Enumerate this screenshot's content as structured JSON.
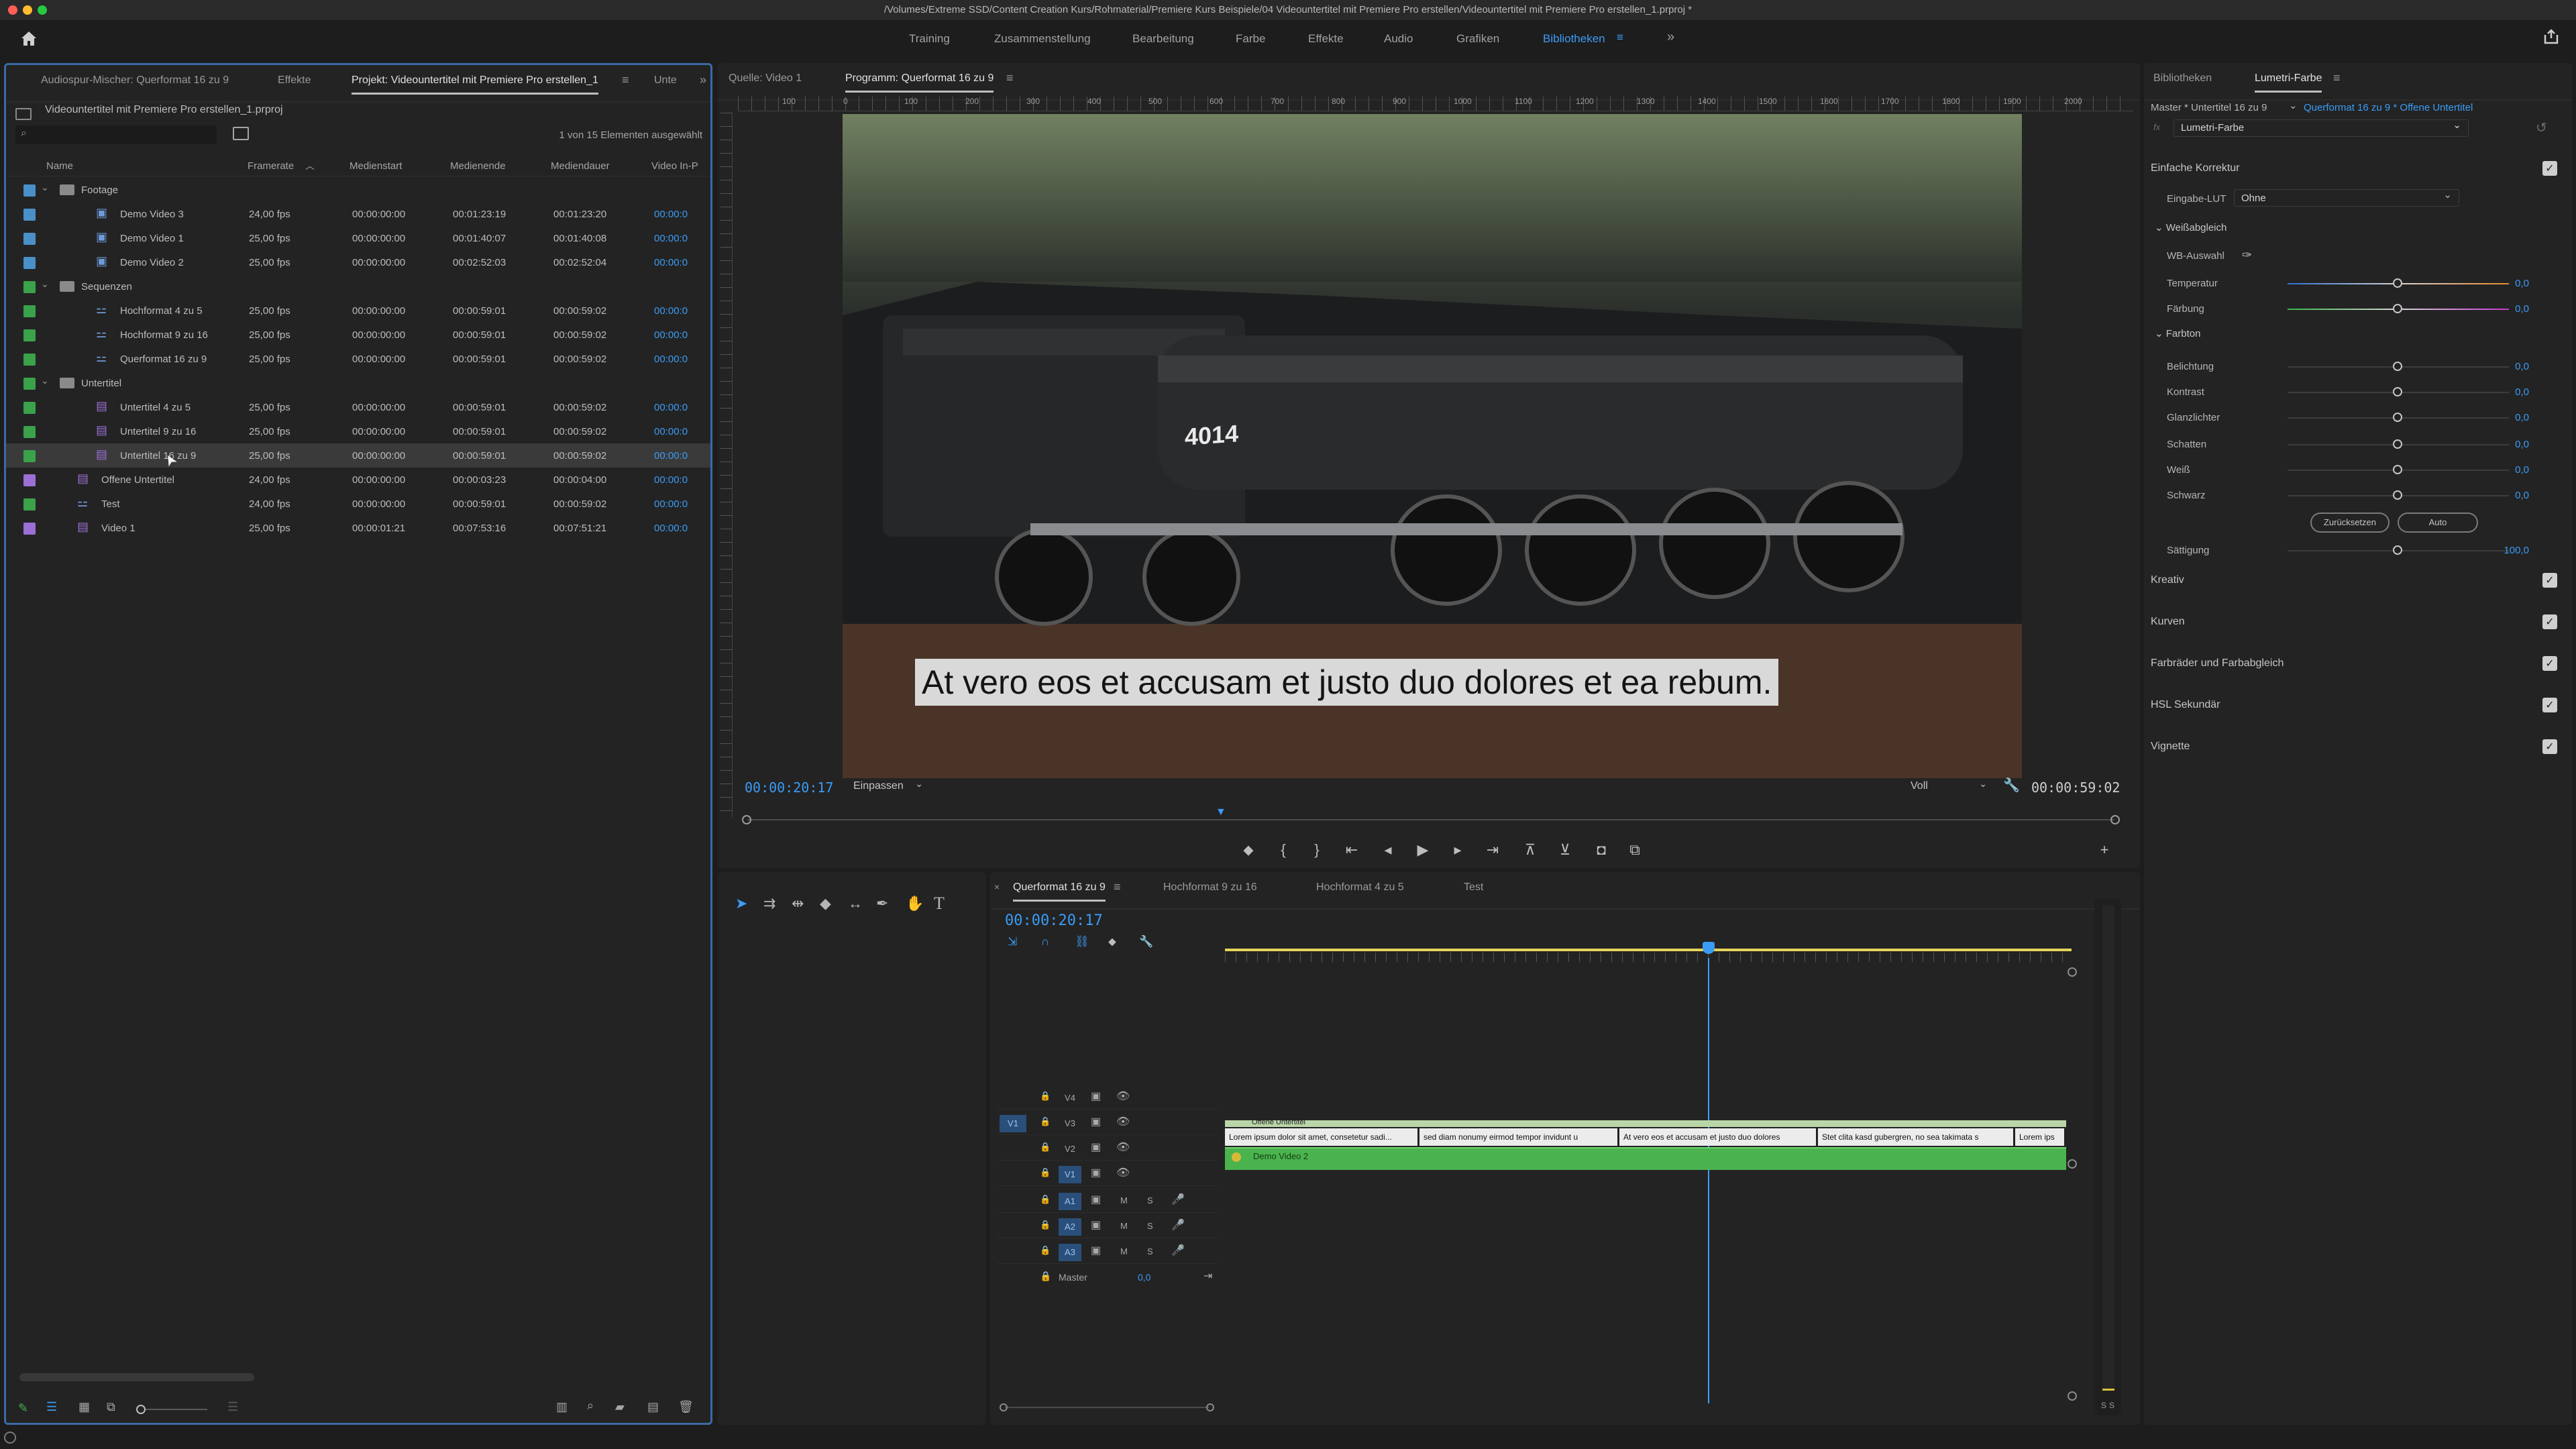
{
  "app": {
    "window_title": "/Volumes/Extreme SSD/Content Creation Kurs/Rohmaterial/Premiere Kurs Beispiele/04 Videountertitel mit Premiere Pro erstellen/Videountertitel mit Premiere Pro erstellen_1.prproj *"
  },
  "workspaces": [
    "Training",
    "Zusammenstellung",
    "Bearbeitung",
    "Farbe",
    "Effekte",
    "Audio",
    "Grafiken",
    "Bibliotheken"
  ],
  "project_panel": {
    "tabs": [
      "Audiospur-Mischer: Querformat 16 zu 9",
      "Effekte",
      "Projekt: Videountertitel mit Premiere Pro erstellen_1",
      "Unte"
    ],
    "project_file": "Videountertitel mit Premiere Pro erstellen_1.prproj",
    "selection_status": "1 von 15 Elementen ausgewählt",
    "columns": [
      "Name",
      "Framerate",
      "Medienstart",
      "Medienende",
      "Mediendauer",
      "Video In-P"
    ],
    "items": [
      {
        "name": "Footage",
        "kind": "bin",
        "indent": 0,
        "label_color": "#4a90c8",
        "framerate": "",
        "start": "",
        "end": "",
        "duration": "",
        "video_in": ""
      },
      {
        "name": "Demo Video 3",
        "kind": "clip",
        "indent": 1,
        "label_color": "#4a90c8",
        "framerate": "24,00 fps",
        "start": "00:00:00:00",
        "end": "00:01:23:19",
        "duration": "00:01:23:20",
        "video_in": "00:00:0"
      },
      {
        "name": "Demo Video 1",
        "kind": "clip",
        "indent": 1,
        "label_color": "#4a90c8",
        "framerate": "25,00 fps",
        "start": "00:00:00:00",
        "end": "00:01:40:07",
        "duration": "00:01:40:08",
        "video_in": "00:00:0"
      },
      {
        "name": "Demo Video 2",
        "kind": "clip",
        "indent": 1,
        "label_color": "#4a90c8",
        "framerate": "25,00 fps",
        "start": "00:00:00:00",
        "end": "00:02:52:03",
        "duration": "00:02:52:04",
        "video_in": "00:00:0"
      },
      {
        "name": "Sequenzen",
        "kind": "bin",
        "indent": 0,
        "label_color": "#3aa24a",
        "framerate": "",
        "start": "",
        "end": "",
        "duration": "",
        "video_in": ""
      },
      {
        "name": "Hochformat 4 zu 5",
        "kind": "sequence",
        "indent": 1,
        "label_color": "#3aa24a",
        "framerate": "25,00 fps",
        "start": "00:00:00:00",
        "end": "00:00:59:01",
        "duration": "00:00:59:02",
        "video_in": "00:00:0"
      },
      {
        "name": "Hochformat 9 zu 16",
        "kind": "sequence",
        "indent": 1,
        "label_color": "#3aa24a",
        "framerate": "25,00 fps",
        "start": "00:00:00:00",
        "end": "00:00:59:01",
        "duration": "00:00:59:02",
        "video_in": "00:00:0"
      },
      {
        "name": "Querformat 16 zu 9",
        "kind": "sequence",
        "indent": 1,
        "label_color": "#3aa24a",
        "framerate": "25,00 fps",
        "start": "00:00:00:00",
        "end": "00:00:59:01",
        "duration": "00:00:59:02",
        "video_in": "00:00:0"
      },
      {
        "name": "Untertitel",
        "kind": "bin",
        "indent": 0,
        "label_color": "#3aa24a",
        "framerate": "",
        "start": "",
        "end": "",
        "duration": "",
        "video_in": ""
      },
      {
        "name": "Untertitel 4 zu 5",
        "kind": "caption",
        "indent": 1,
        "label_color": "#3aa24a",
        "framerate": "25,00 fps",
        "start": "00:00:00:00",
        "end": "00:00:59:01",
        "duration": "00:00:59:02",
        "video_in": "00:00:0"
      },
      {
        "name": "Untertitel 9 zu 16",
        "kind": "caption",
        "indent": 1,
        "label_color": "#3aa24a",
        "framerate": "25,00 fps",
        "start": "00:00:00:00",
        "end": "00:00:59:01",
        "duration": "00:00:59:02",
        "video_in": "00:00:0"
      },
      {
        "name": "Untertitel 16 zu 9",
        "kind": "caption",
        "indent": 1,
        "label_color": "#3aa24a",
        "framerate": "25,00 fps",
        "start": "00:00:00:00",
        "end": "00:00:59:01",
        "duration": "00:00:59:02",
        "video_in": "00:00:0",
        "selected": true
      },
      {
        "name": "Offene Untertitel",
        "kind": "caption",
        "indent": 0,
        "label_color": "#9b6fd6",
        "framerate": "24,00 fps",
        "start": "00:00:00:00",
        "end": "00:00:03:23",
        "duration": "00:00:04:00",
        "video_in": "00:00:0"
      },
      {
        "name": "Test",
        "kind": "sequence",
        "indent": 0,
        "label_color": "#3aa24a",
        "framerate": "24,00 fps",
        "start": "00:00:00:00",
        "end": "00:00:59:01",
        "duration": "00:00:59:02",
        "video_in": "00:00:0"
      },
      {
        "name": "Video 1",
        "kind": "caption",
        "indent": 0,
        "label_color": "#9b6fd6",
        "framerate": "25,00 fps",
        "start": "00:00:01:21",
        "end": "00:07:53:16",
        "duration": "00:07:51:21",
        "video_in": "00:00:0"
      }
    ]
  },
  "monitor": {
    "tabs": [
      "Quelle: Video 1",
      "Programm: Querformat 16 zu 9"
    ],
    "ruler_labels": [
      "100",
      "0",
      "100",
      "200",
      "300",
      "400",
      "500",
      "600",
      "700",
      "800",
      "900",
      "1000",
      "1100",
      "1200",
      "1300",
      "1400",
      "1500",
      "1600",
      "1700",
      "1800",
      "1900",
      "2000"
    ],
    "locomotive_number": "4014",
    "subtitle_text": "At vero eos et accusam et justo duo dolores et ea rebum.",
    "current_timecode": "00:00:20:17",
    "zoom_fit": "Einpassen",
    "resolution": "Voll",
    "duration_timecode": "00:00:59:02"
  },
  "timeline": {
    "tabs": [
      "Querformat 16 zu 9",
      "Hochformat 9 zu 16",
      "Hochformat 4 zu 5",
      "Test"
    ],
    "current_timecode": "00:00:20:17",
    "subtitle_track_name": "Offene Untertitel",
    "video_clip_name": "Demo Video 2",
    "video_tracks": [
      {
        "name": "V4",
        "source_patch": ""
      },
      {
        "name": "V3",
        "source_patch": "V1"
      },
      {
        "name": "V2",
        "source_patch": ""
      },
      {
        "name": "V1",
        "source_patch": ""
      }
    ],
    "audio_tracks": [
      {
        "name": "A1",
        "mute": "M",
        "solo": "S"
      },
      {
        "name": "A2",
        "mute": "M",
        "solo": "S"
      },
      {
        "name": "A3",
        "mute": "M",
        "solo": "S"
      }
    ],
    "master": {
      "label": "Master",
      "value": "0,0"
    },
    "subtitle_clips": [
      "Lorem ipsum dolor sit amet, consetetur sadi...",
      "sed diam nonumy eirmod tempor invidunt u",
      "At vero eos et accusam et justo duo dolores",
      "Stet clita kasd gubergren, no sea takimata s",
      "Lorem ips"
    ]
  },
  "audio_meter": {
    "solo_left": "S",
    "solo_right": "S"
  },
  "lumetri": {
    "tabs": [
      "Bibliotheken",
      "Lumetri-Farbe"
    ],
    "master_clip": "Master * Untertitel 16 zu 9",
    "sequence_clip": "Querformat 16 zu 9 * Offene Untertitel",
    "effect_instance": "Lumetri-Farbe",
    "sections": [
      "Einfache Korrektur",
      "Kreativ",
      "Kurven",
      "Farbräder und Farbabgleich",
      "HSL Sekundär",
      "Vignette"
    ],
    "input_lut_label": "Eingabe-LUT",
    "input_lut_value": "Ohne",
    "white_balance_title": "Weißabgleich",
    "wb_selector_label": "WB-Auswahl",
    "tone_title": "Farbton",
    "reset_label": "Zurücksetzen",
    "auto_label": "Auto",
    "sliders": [
      {
        "label": "Temperatur",
        "value": "0,0",
        "position": 0.5,
        "track": "temperature"
      },
      {
        "label": "Färbung",
        "value": "0,0",
        "position": 0.5,
        "track": "tint"
      },
      {
        "label": "Belichtung",
        "value": "0,0",
        "position": 0.5,
        "track": "plain"
      },
      {
        "label": "Kontrast",
        "value": "0,0",
        "position": 0.5,
        "track": "plain"
      },
      {
        "label": "Glanzlichter",
        "value": "0,0",
        "position": 0.5,
        "track": "plain"
      },
      {
        "label": "Schatten",
        "value": "0,0",
        "position": 0.5,
        "track": "plain"
      },
      {
        "label": "Weiß",
        "value": "0,0",
        "position": 0.5,
        "track": "plain"
      },
      {
        "label": "Schwarz",
        "value": "0,0",
        "position": 0.5,
        "track": "plain"
      },
      {
        "label": "Sättigung",
        "value": "100,0",
        "position": 0.5,
        "track": "plain"
      }
    ]
  }
}
